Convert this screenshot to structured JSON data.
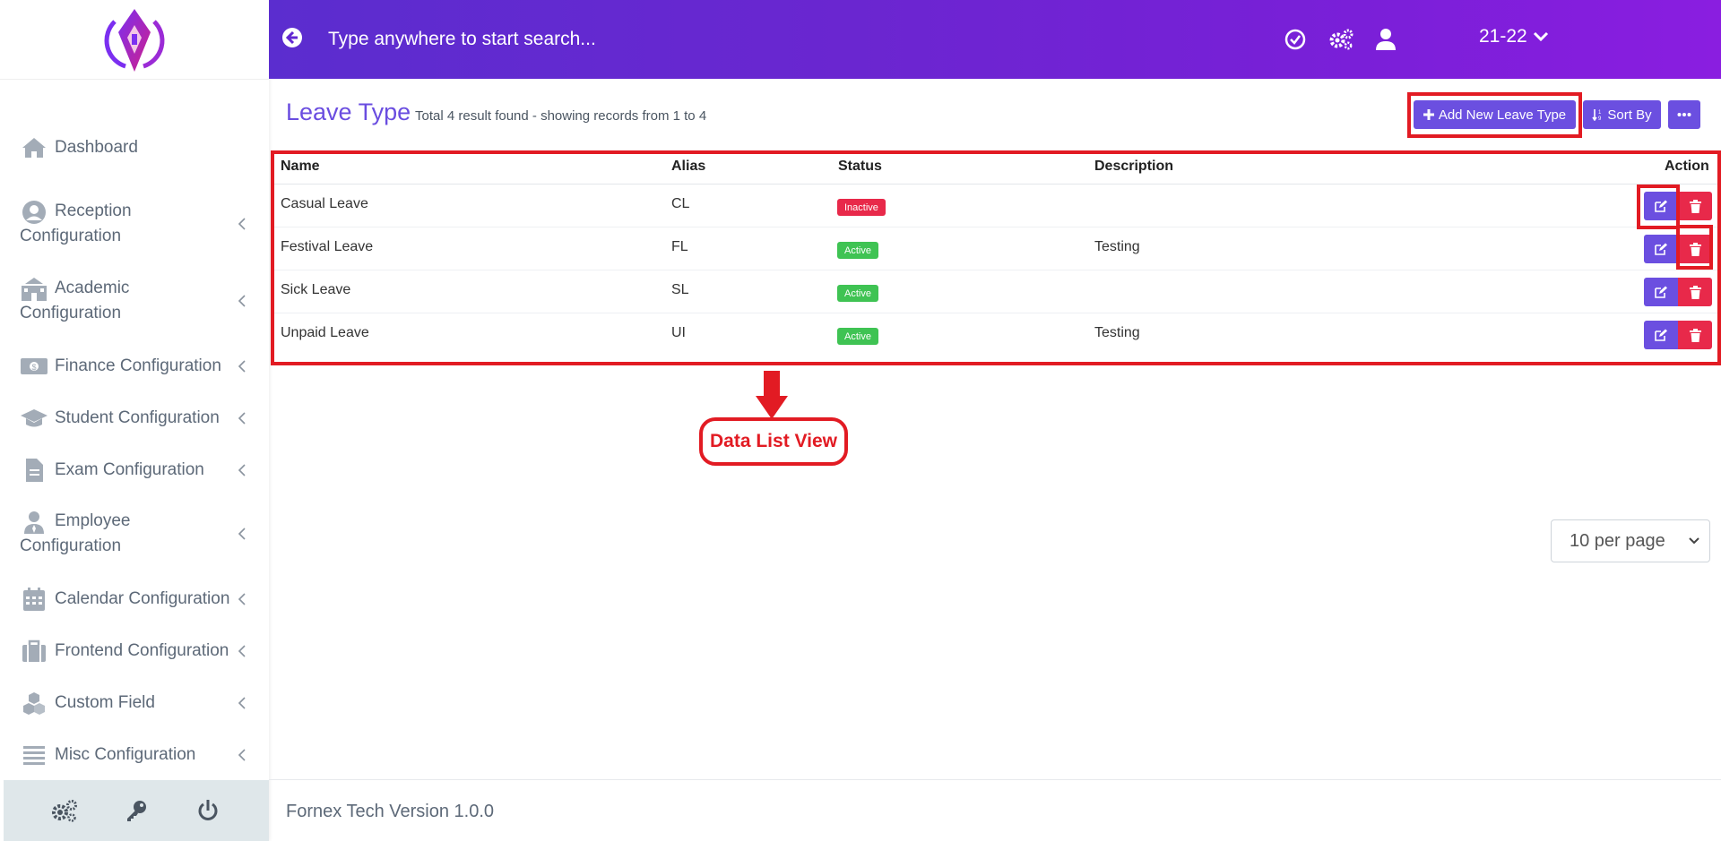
{
  "header": {
    "search_placeholder": "Type anywhere to start search...",
    "session": "21-22"
  },
  "sidebar": {
    "items": [
      {
        "label": "Dashboard"
      },
      {
        "label": "Reception Configuration"
      },
      {
        "label": "Academic Configuration"
      },
      {
        "label": "Finance Configuration"
      },
      {
        "label": "Student Configuration"
      },
      {
        "label": "Exam Configuration"
      },
      {
        "label": "Employee Configuration"
      },
      {
        "label": "Calendar Configuration"
      },
      {
        "label": "Frontend Configuration"
      },
      {
        "label": "Custom Field"
      },
      {
        "label": "Misc Configuration"
      }
    ]
  },
  "page": {
    "title": "Leave Type",
    "summary": "Total 4 result found - showing records from 1 to 4",
    "add_button": "Add New Leave Type",
    "sort_button": "Sort By"
  },
  "table": {
    "columns": [
      "Name",
      "Alias",
      "Status",
      "Description",
      "Action"
    ],
    "rows": [
      {
        "name": "Casual Leave",
        "alias": "CL",
        "status": "Inactive",
        "description": ""
      },
      {
        "name": "Festival Leave",
        "alias": "FL",
        "status": "Active",
        "description": "Testing"
      },
      {
        "name": "Sick Leave",
        "alias": "SL",
        "status": "Active",
        "description": ""
      },
      {
        "name": "Unpaid Leave",
        "alias": "UI",
        "status": "Active",
        "description": "Testing"
      }
    ]
  },
  "annotation": {
    "label": "Data List View"
  },
  "pagination": {
    "per_page": "10 per page"
  },
  "footer": {
    "version": "Fornex Tech Version 1.0.0"
  },
  "colors": {
    "accent": "#6b4fe0",
    "danger": "#e8294a",
    "success": "#3fc353",
    "annotation": "#e21b23"
  }
}
